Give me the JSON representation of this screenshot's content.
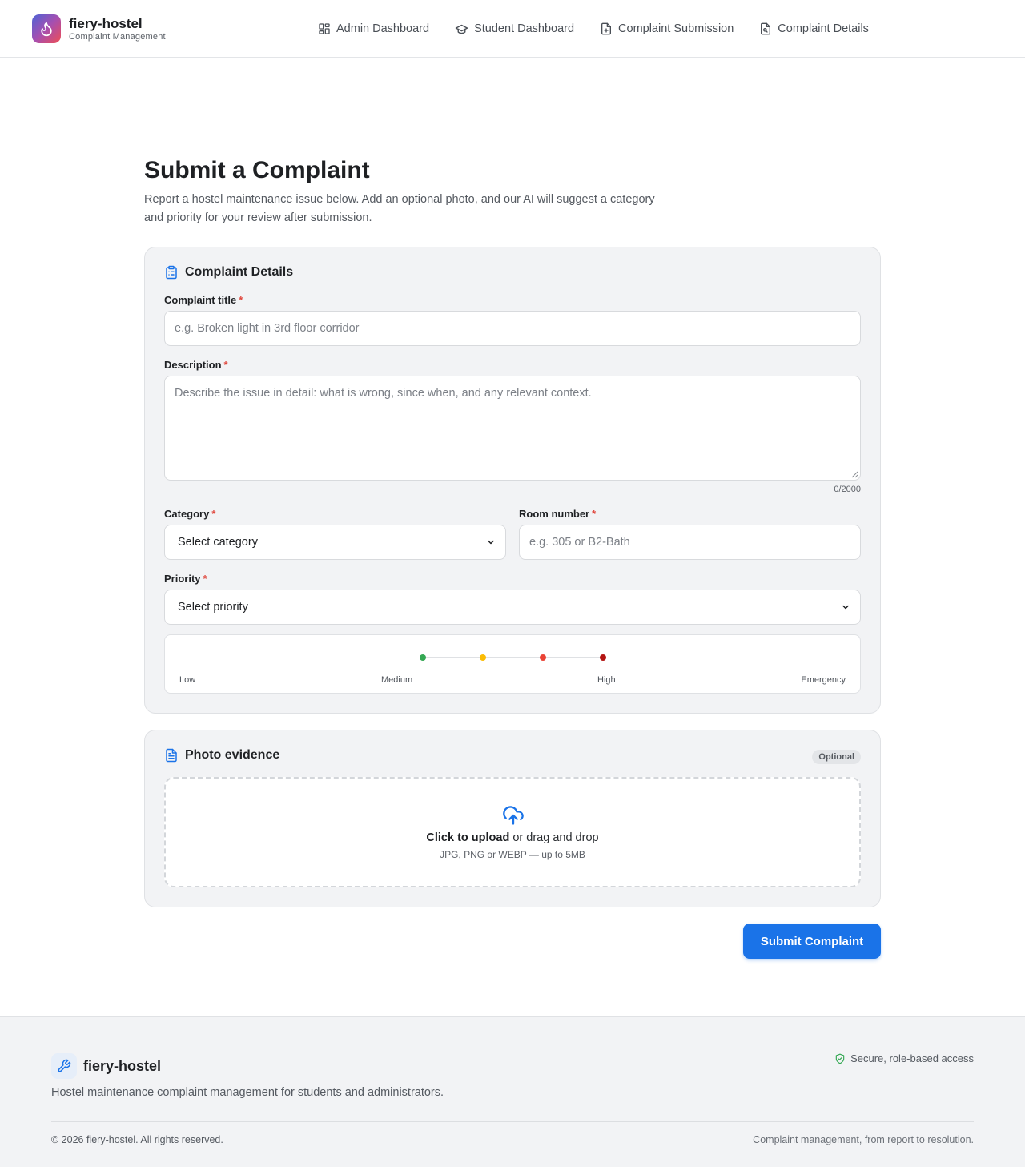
{
  "header": {
    "brand_name": "fiery-hostel",
    "brand_sub": "Complaint Management",
    "nav": [
      {
        "label": "Admin Dashboard",
        "icon": "grid-icon"
      },
      {
        "label": "Student Dashboard",
        "icon": "graduation-cap-icon"
      },
      {
        "label": "Complaint Submission",
        "icon": "file-plus-icon"
      },
      {
        "label": "Complaint Details",
        "icon": "file-search-icon"
      }
    ]
  },
  "page": {
    "title": "Submit a Complaint",
    "description": "Report a hostel maintenance issue below. Add an optional photo, and our AI will suggest a category and priority for your review after submission."
  },
  "details_card": {
    "title": "Complaint Details",
    "title_label": "Complaint title",
    "title_placeholder": "e.g. Broken light in 3rd floor corridor",
    "description_label": "Description",
    "description_placeholder": "Describe the issue in detail: what is wrong, since when, and any relevant context.",
    "char_counter": "0/2000",
    "category_label": "Category",
    "category_value": "Select category",
    "room_label": "Room number",
    "room_placeholder": "e.g. 305 or B2-Bath",
    "priority_label": "Priority",
    "priority_value": "Select priority",
    "required_mark": "*",
    "priority_scale": {
      "levels": [
        "Low",
        "Medium",
        "High",
        "Emergency"
      ],
      "colors": [
        "#34a853",
        "#fbbc04",
        "#ea4335",
        "#b31412"
      ]
    }
  },
  "photo_card": {
    "title": "Photo evidence",
    "badge": "Optional",
    "upload_strong": "Click to upload",
    "upload_rest": " or drag and drop",
    "upload_hint": "JPG, PNG or WEBP — up to 5MB"
  },
  "submit_label": "Submit Complaint",
  "footer": {
    "brand_name": "fiery-hostel",
    "description": "Hostel maintenance complaint management for students and administrators.",
    "secure_text": "Secure, role-based access",
    "copyright": "© 2026 fiery-hostel. All rights reserved.",
    "tagline": "Complaint management, from report to resolution."
  },
  "colors": {
    "accent": "#1a73e8",
    "required": "#e0473d",
    "secure": "#34a853"
  }
}
